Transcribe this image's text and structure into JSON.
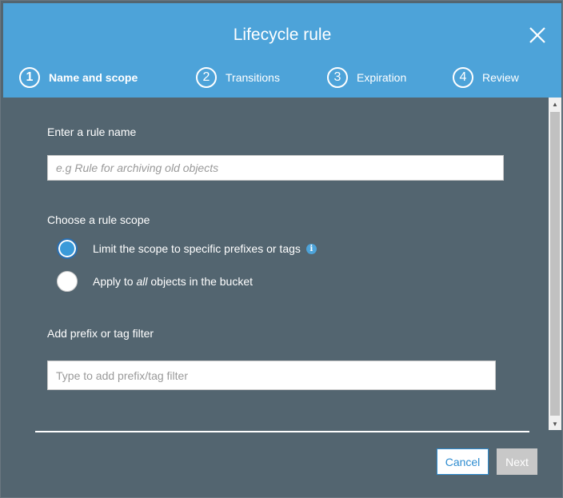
{
  "dialog": {
    "title": "Lifecycle rule",
    "close_icon": "close-icon"
  },
  "steps": [
    {
      "number": "1",
      "label": "Name and scope",
      "active": true
    },
    {
      "number": "2",
      "label": "Transitions",
      "active": false
    },
    {
      "number": "3",
      "label": "Expiration",
      "active": false
    },
    {
      "number": "4",
      "label": "Review",
      "active": false
    }
  ],
  "rule_name": {
    "label": "Enter a rule name",
    "value": "",
    "placeholder": "e.g Rule for archiving old objects"
  },
  "scope": {
    "label": "Choose a rule scope",
    "options": [
      {
        "label": "Limit the scope to specific prefixes or tags",
        "selected": true,
        "info_icon": "info-icon"
      },
      {
        "label_before": "Apply to ",
        "label_emphasis": "all",
        "label_after": " objects in the bucket",
        "selected": false
      }
    ]
  },
  "filter": {
    "label": "Add prefix or tag filter",
    "value": "",
    "placeholder": "Type to add prefix/tag filter"
  },
  "footer": {
    "cancel_label": "Cancel",
    "next_label": "Next"
  },
  "colors": {
    "header_bg": "#4da3d9",
    "body_bg": "#536570",
    "accent": "#2d8cd0",
    "disabled_button": "#c8c8c8"
  }
}
